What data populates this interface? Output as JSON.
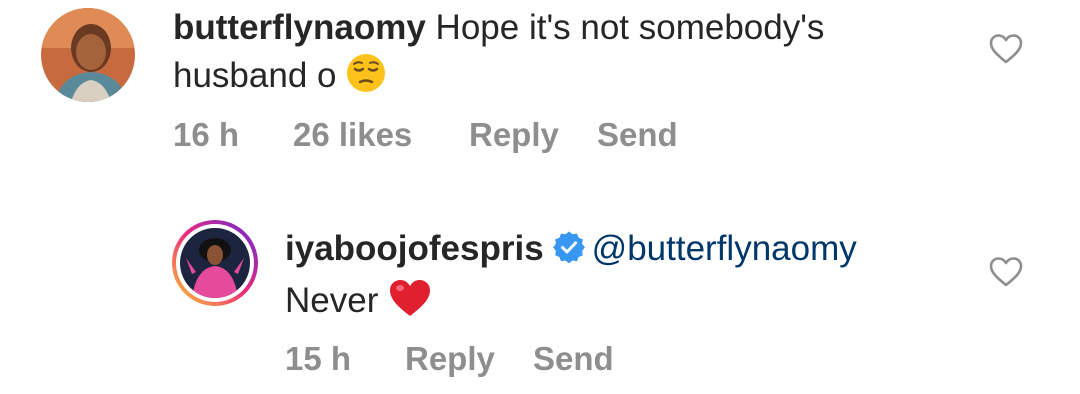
{
  "comment": {
    "username": "butterflynaomy",
    "text_line1": "Hope it's not somebody's",
    "text_line2": "husband o",
    "emoji_icon": "pensive-face-emoji",
    "time": "16 h",
    "likes": "26 likes",
    "reply_label": "Reply",
    "send_label": "Send",
    "like_icon": "heart-outline-icon"
  },
  "reply": {
    "username": "iyaboojofespris",
    "verified_icon": "verified-badge-icon",
    "mention": "@butterflynaomy",
    "text": "Never",
    "emoji_icon": "red-heart-emoji",
    "time": "15 h",
    "reply_label": "Reply",
    "send_label": "Send",
    "like_icon": "heart-outline-icon"
  },
  "colors": {
    "text": "#262626",
    "secondary": "#8e8e8e",
    "mention": "#00376b",
    "verified": "#3897f0",
    "story_ring_start": "#f9ce34",
    "story_ring_end": "#ee2a7b"
  }
}
